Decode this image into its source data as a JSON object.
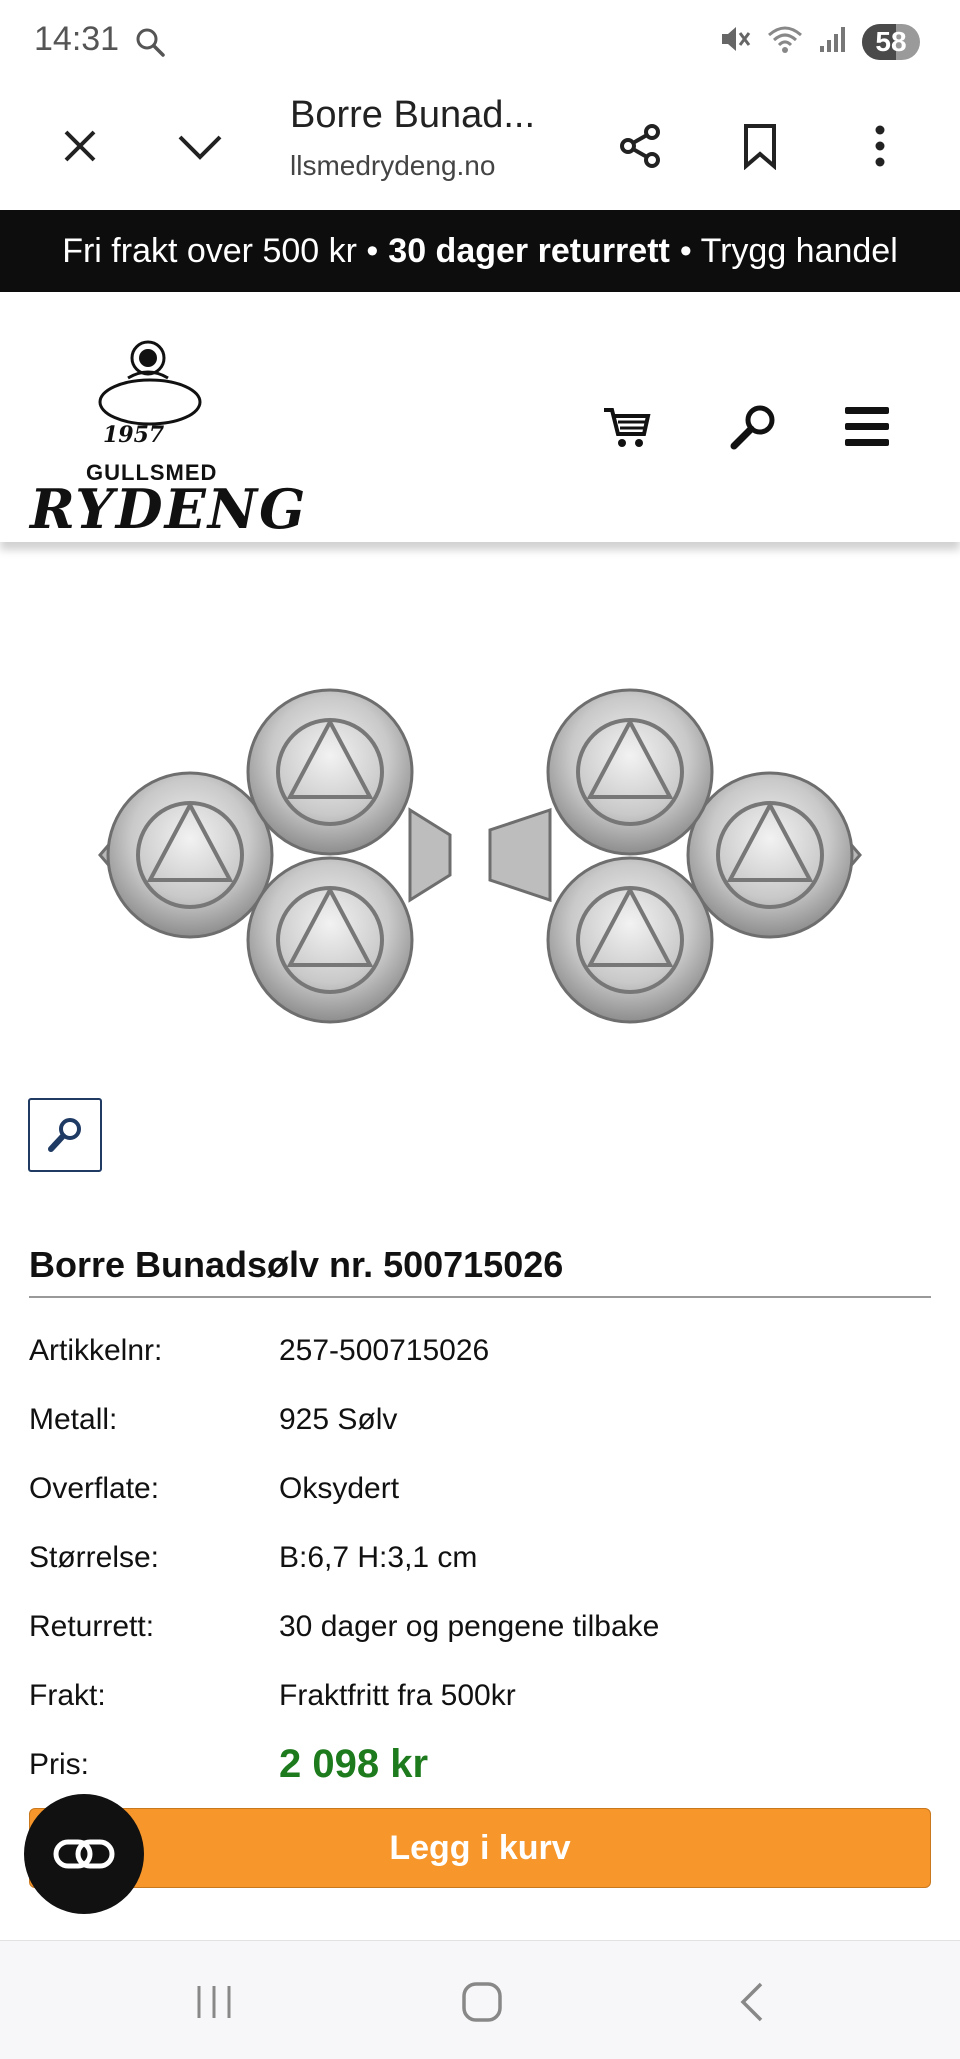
{
  "status_bar": {
    "time": "14:31",
    "battery": "58",
    "battery_level": 0.58
  },
  "browser": {
    "title": "Borre Bunad...",
    "url": "llsmedrydeng.no",
    "icons": [
      "close-icon",
      "chevron-down-icon",
      "share-icon",
      "bookmark-icon",
      "more-vert-icon"
    ]
  },
  "promo": {
    "part1": "Fri frakt over 500 kr •",
    "part2": "30 dager returrett",
    "part3": "• Trygg handel"
  },
  "header": {
    "logo": {
      "year": "1957",
      "top": "GULLSMED",
      "name": "RYDENG"
    },
    "icons": [
      "cart-icon",
      "search-icon",
      "menu-icon"
    ]
  },
  "product": {
    "title": "Borre Bunadsølv nr. 500715026",
    "specs": [
      {
        "label": "Artikkelnr:",
        "value": "257-500715026"
      },
      {
        "label": "Metall:",
        "value": "925 Sølv"
      },
      {
        "label": "Overflate:",
        "value": "Oksydert"
      },
      {
        "label": "Størrelse:",
        "value": "B:6,7 H:3,1 cm"
      },
      {
        "label": "Returrett:",
        "value": "30 dager og pengene tilbake"
      },
      {
        "label": "Frakt:",
        "value": "Fraktfritt fra 500kr"
      }
    ],
    "price_label": "Pris:",
    "price": "2 098 kr",
    "cart_button": "Legg i kurv"
  },
  "colors": {
    "promo_bg": "#0d0d0d",
    "price": "#1d7a1d",
    "cart_button": "#f7962a",
    "zoom_border": "#1f3a63"
  }
}
